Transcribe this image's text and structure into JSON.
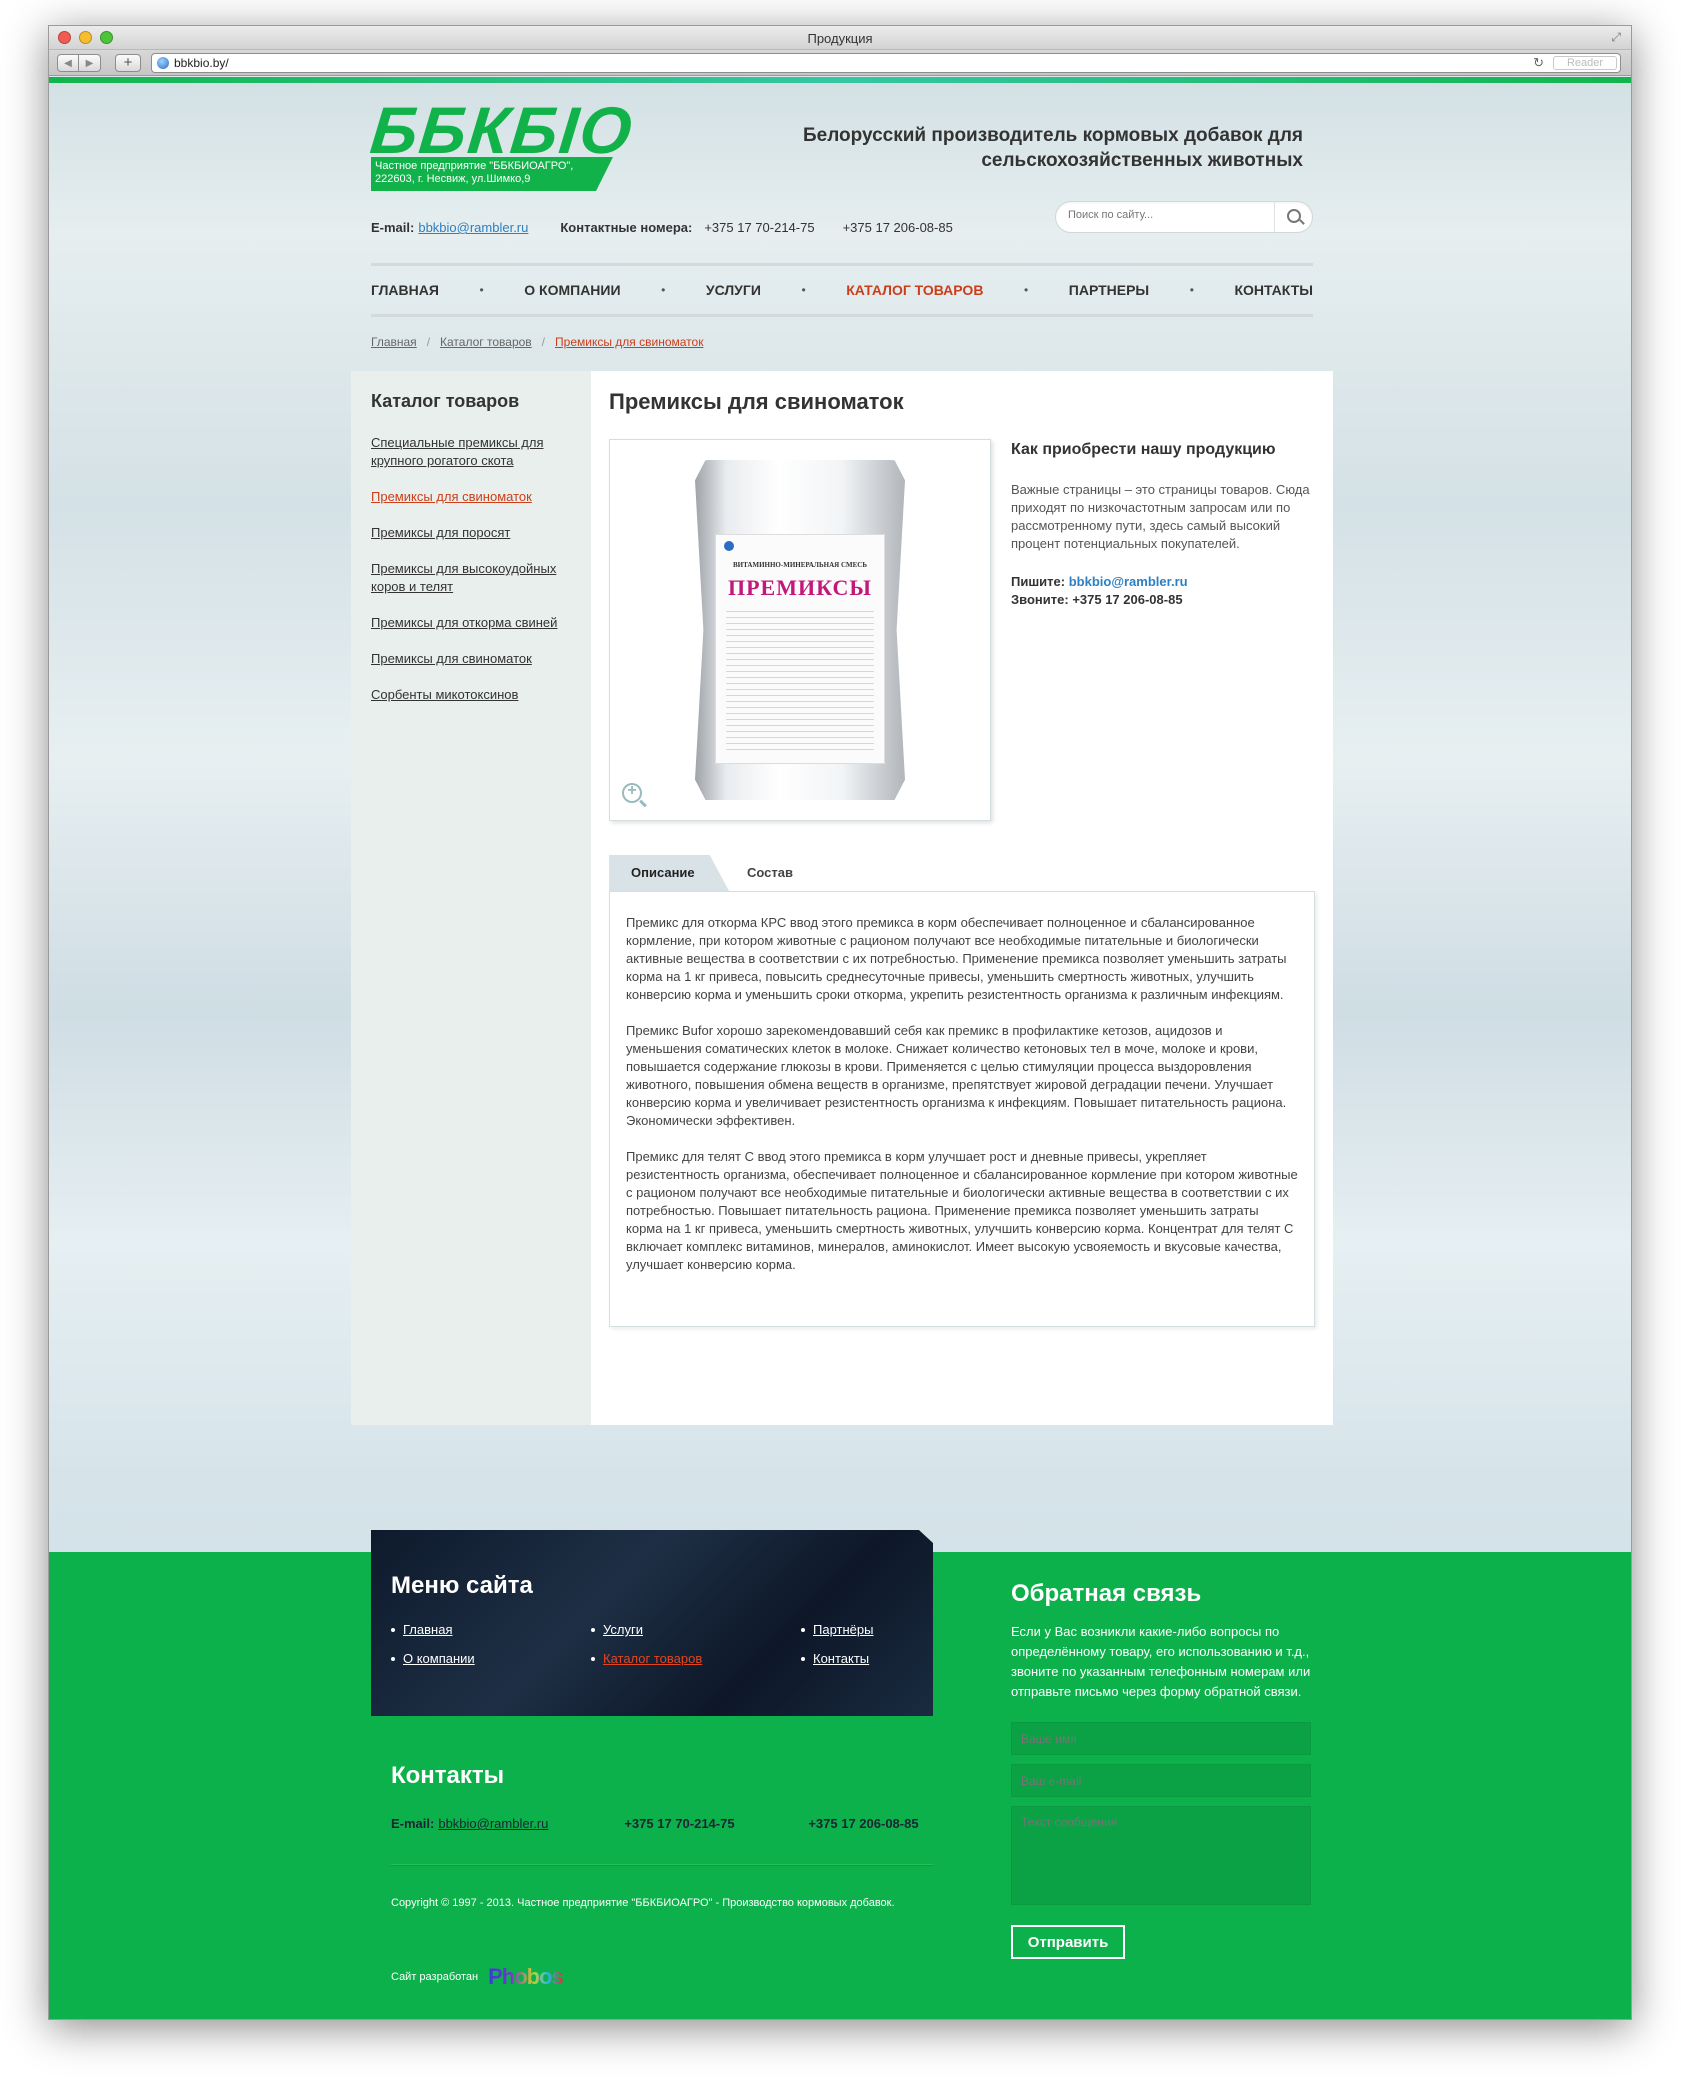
{
  "window": {
    "title": "Продукция",
    "url": "bbkbio.by/",
    "reader": "Reader"
  },
  "header": {
    "logo": "ББКБІО",
    "logo_sub": "Частное предприятие \"ББКБИОАГРО\", 222603, г. Несвиж, ул.Шимко,9",
    "tagline": "Белорусский производитель кормовых добавок для сельскохозяйственных животных",
    "email_label": "E-mail:",
    "email": "bbkbio@rambler.ru",
    "phones_label": "Контактные номера:",
    "phone1": "+375 17 70-214-75",
    "phone2": "+375 17 206-08-85",
    "search_placeholder": "Поиск по сайту..."
  },
  "nav": {
    "items": [
      {
        "label": "Главная"
      },
      {
        "label": "О компании"
      },
      {
        "label": "Услуги"
      },
      {
        "label": "Каталог товаров"
      },
      {
        "label": "Партнеры"
      },
      {
        "label": "Контакты"
      }
    ],
    "separator": "•"
  },
  "breadcrumb": {
    "items": [
      "Главная",
      "Каталог товаров",
      "Премиксы для свиноматок"
    ],
    "sep": "/"
  },
  "sidebar": {
    "title": "Каталог товаров",
    "items": [
      "Специальные премиксы для крупного рогатого скота",
      "Премиксы для свиноматок",
      "Премиксы для поросят",
      "Премиксы для высокоудойных коров и телят",
      "Премиксы для откорма свиней",
      "Премиксы для свиноматок",
      "Сорбенты микотоксинов"
    ]
  },
  "product": {
    "title": "Премиксы для свиноматок",
    "bag_subtitle": "ВИТАМИННО-МИНЕРАЛЬНАЯ СМЕСЬ",
    "bag_name": "ПРЕМИКСЫ",
    "buy_title": "Как приобрести нашу продукцию",
    "buy_text": "Важные страницы – это страницы товаров. Сюда приходят по низкочастотным запросам или по рассмотренному пути, здесь самый высокий процент потенциальных покупателей.",
    "write_label": "Пишите:",
    "write_value": "bbkbio@rambler.ru",
    "call_label": "Звоните:",
    "call_value": "+375 17 206-08-85",
    "tabs": [
      "Описание",
      "Состав"
    ],
    "paragraphs": [
      "Премикс для откорма КРС ввод этого премикса в корм  обеспечивает полноценное  и сбалансированное кормление, при котором животные с рационом получают все необходимые питательные и биологически активные вещества в соответствии с их потребностью. Применение премикса позволяет уменьшить затраты корма на 1 кг привеса, повысить среднесуточные привесы, уменьшить смертность животных, улучшить конверсию корма и уменьшить сроки откорма, укрепить резистентность организма к различным инфекциям.",
      "Премикс Bufor хорошо зарекомендовавший себя как премикс в профилактике  кетозов, ацидозов и уменьшения соматических клеток в молоке. Снижает количество кетоновых тел в моче, молоке и крови, повышается содержание глюкозы в крови. Применяется с целью стимуляции процесса выздоровления животного, повышения обмена веществ в организме, препятствует жировой деградации печени. Улучшает конверсию корма и увеличивает резистентность организма к инфекциям. Повышает питательность рациона. Экономически эффективен.",
      "Премикс для телят С ввод этого  премикса в корм улучшает рост и дневные привесы, укрепляет резистентность организма, обеспечивает полноценное  и  сбалансированное кормление при котором животные с рационом получают все необходимые питательные и биологически активные вещества в соответствии с их потребностью. Повышает питательность рациона. Применение премикса позволяет уменьшить затраты корма на 1 кг привеса, уменьшить смертность животных, улучшить конверсию корма. Концентрат для телят С включает комплекс витаминов, минералов, аминокислот. Имеет высокую усвояемость и вкусовые качества, улучшает конверсию корма."
    ]
  },
  "footer": {
    "menu_title": "Меню сайта",
    "menu": [
      "Главная",
      "Услуги",
      "Партнёры",
      "О компании",
      "Каталог товаров",
      "Контакты"
    ],
    "contacts_title": "Контакты",
    "email_label": "E-mail:",
    "email": "bbkbio@rambler.ru",
    "phone1": "+375 17 70-214-75",
    "phone2": "+375 17 206-08-85",
    "copyright": "Copyright © 1997 - 2013. Частное предприятие \"ББКБИОАГРО\" - Производство кормовых добавок.",
    "dev_label": "Сайт разработан",
    "dev_logo": "Phobos",
    "feedback_title": "Обратная связь",
    "feedback_text": "Если у Вас возникли какие-либо вопросы по определённому товару, его использованию и т.д., звоните по указанным телефонным номерам или отправьте письмо через форму обратной связи.",
    "name_placeholder": "Ваше имя",
    "email_placeholder": "Ваш e-mail",
    "message_placeholder": "Текст сообщения",
    "submit": "Отправить"
  },
  "colors": {
    "brand_green": "#11b24a",
    "active_red": "#cc3e19",
    "link_blue": "#2c80c3",
    "footer_dark": "#0e1a2c"
  }
}
